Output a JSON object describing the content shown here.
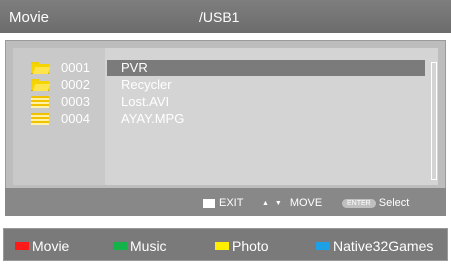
{
  "header": {
    "title": "Movie",
    "path": "/USB1"
  },
  "files": [
    {
      "number": "0001",
      "name": "PVR",
      "type": "folder",
      "selected": true,
      "icon": "folder-icon"
    },
    {
      "number": "0002",
      "name": "Recycler",
      "type": "folder",
      "selected": false,
      "icon": "folder-icon"
    },
    {
      "number": "0003",
      "name": "Lost.AVI",
      "type": "file",
      "selected": false,
      "icon": "file-icon"
    },
    {
      "number": "0004",
      "name": "AYAY.MPG",
      "type": "file",
      "selected": false,
      "icon": "file-icon"
    }
  ],
  "help": {
    "exit_label": "EXIT",
    "move_arrows": "▲ ▼",
    "move_label": "MOVE",
    "enter_key": "ENTER",
    "select_label": "Select"
  },
  "tabs": [
    {
      "label": "Movie",
      "color": "#ff1a1a"
    },
    {
      "label": "Music",
      "color": "#13b34a"
    },
    {
      "label": "Photo",
      "color": "#ffee00"
    },
    {
      "label": "Native32Games",
      "color": "#1ea0e6"
    }
  ],
  "colors": {
    "highlight": "#7b7b7b",
    "header": "#747474",
    "panel": "#bdbdbd"
  }
}
